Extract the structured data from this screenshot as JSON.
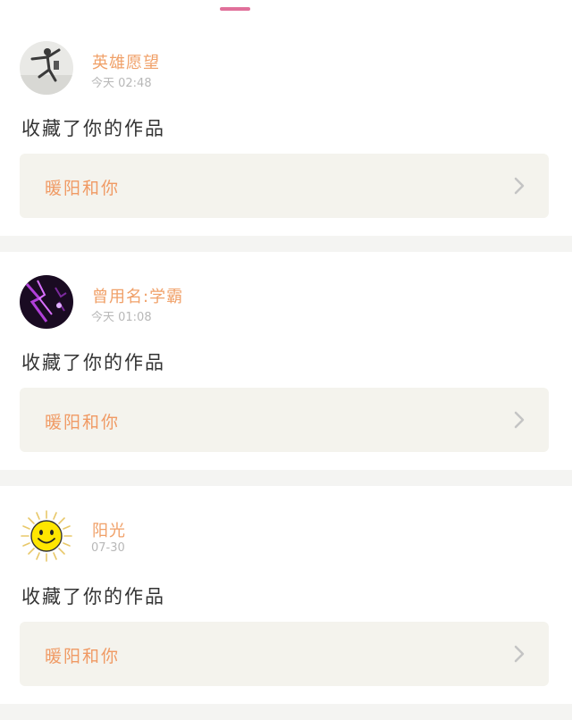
{
  "notifications": [
    {
      "avatar_icon": "dancer-photo-avatar",
      "username": "英雄愿望",
      "time": "今天 02:48",
      "action": "收藏了你的作品",
      "work_title": "暖阳和你"
    },
    {
      "avatar_icon": "purple-lightning-avatar",
      "username": "曾用名:学霸",
      "time": "今天 01:08",
      "action": "收藏了你的作品",
      "work_title": "暖阳和你"
    },
    {
      "avatar_icon": "smiley-sun-avatar",
      "username": "阳光",
      "time": "07-30",
      "action": "收藏了你的作品",
      "work_title": "暖阳和你"
    }
  ],
  "colors": {
    "accent": "#e0709a",
    "username": "#f0a068",
    "work_title": "#f09a64",
    "work_bg": "#f4f3ed",
    "separator": "#f4f4f2"
  }
}
